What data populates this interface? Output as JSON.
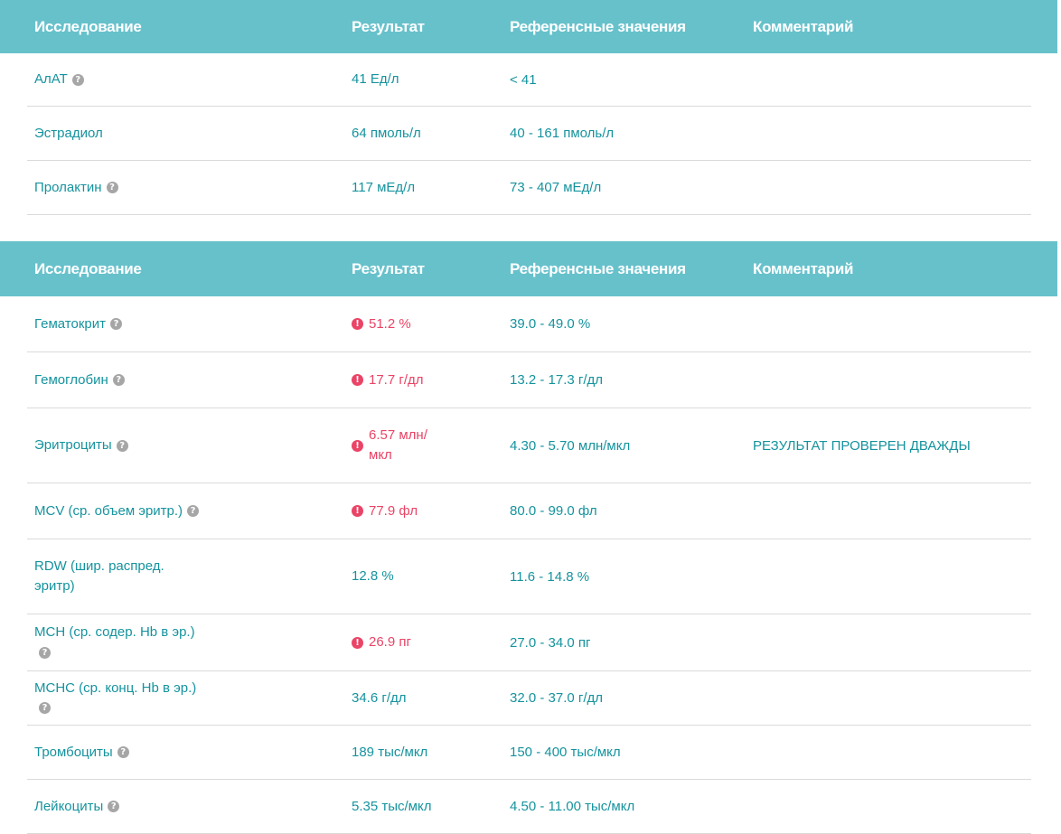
{
  "headers": {
    "test": "Исследование",
    "result": "Результат",
    "reference": "Референсные значения",
    "comment": "Комментарий"
  },
  "table1": [
    {
      "name": "АлАТ",
      "result": "41 Ед/л",
      "reference": "< 41",
      "comment": "",
      "help": true,
      "abnormal": false
    },
    {
      "name": "Эстрадиол",
      "result": "64 пмоль/л",
      "reference": "40 - 161 пмоль/л",
      "comment": "",
      "help": false,
      "abnormal": false
    },
    {
      "name": "Пролактин",
      "result": "117 мЕд/л",
      "reference": "73 - 407 мЕд/л",
      "comment": "",
      "help": true,
      "abnormal": false
    }
  ],
  "table2": [
    {
      "name": "Гематокрит",
      "result": "51.2 %",
      "reference": "39.0 - 49.0 %",
      "comment": "",
      "help": true,
      "abnormal": true
    },
    {
      "name": "Гемоглобин",
      "result": "17.7 г/дл",
      "reference": "13.2 - 17.3 г/дл",
      "comment": "",
      "help": true,
      "abnormal": true
    },
    {
      "name": "Эритроциты",
      "result": "6.57 млн/мкл",
      "reference": "4.30 - 5.70 млн/мкл",
      "comment": "РЕЗУЛЬТАТ ПРОВЕРЕН ДВАЖДЫ",
      "help": true,
      "abnormal": true
    },
    {
      "name": "MCV (ср. объем эритр.)",
      "result": "77.9 фл",
      "reference": "80.0 - 99.0 фл",
      "comment": "",
      "help": true,
      "abnormal": true
    },
    {
      "name": "RDW (шир. распред. эритр)",
      "result": "12.8 %",
      "reference": "11.6 - 14.8 %",
      "comment": "",
      "help": false,
      "abnormal": false
    },
    {
      "name": "MCH (ср. содер. Hb в эр.)",
      "result": "26.9 пг",
      "reference": "27.0 - 34.0 пг",
      "comment": "",
      "help": true,
      "abnormal": true
    },
    {
      "name": "MCHC (ср. конц. Hb в эр.)",
      "result": "34.6 г/дл",
      "reference": "32.0 - 37.0 г/дл",
      "comment": "",
      "help": true,
      "abnormal": false
    },
    {
      "name": "Тромбоциты",
      "result": "189 тыс/мкл",
      "reference": "150 - 400 тыс/мкл",
      "comment": "",
      "help": true,
      "abnormal": false
    },
    {
      "name": "Лейкоциты",
      "result": "5.35 тыс/мкл",
      "reference": "4.50 - 11.00 тыс/мкл",
      "comment": "",
      "help": true,
      "abnormal": false
    }
  ],
  "colors": {
    "header_bg": "#67c1cb",
    "text": "#15939e",
    "abnormal": "#ea4466",
    "help_icon": "#a6a6a6"
  }
}
